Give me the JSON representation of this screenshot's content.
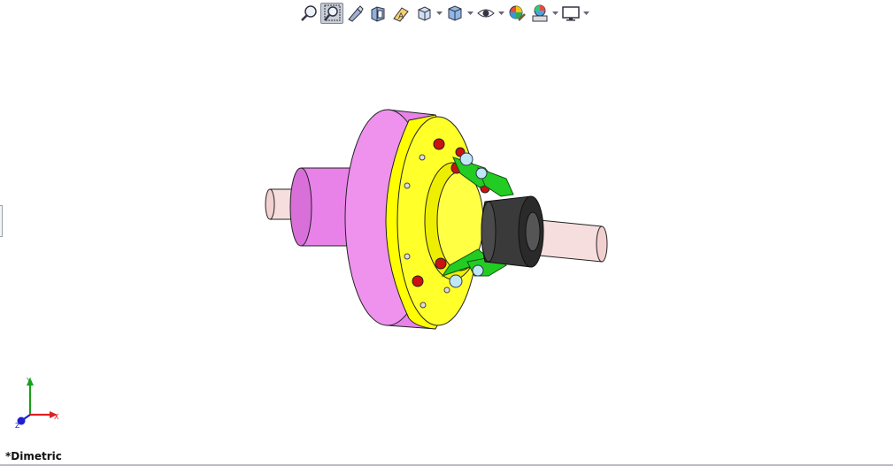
{
  "toolbar": {
    "tools": [
      {
        "name": "zoom-to-fit-icon",
        "dropdown": false,
        "active": false
      },
      {
        "name": "zoom-to-area-icon",
        "dropdown": false,
        "active": true
      },
      {
        "name": "previous-view-icon",
        "dropdown": false,
        "active": false
      },
      {
        "name": "section-view-icon",
        "dropdown": false,
        "active": false
      },
      {
        "name": "dynamic-annotation-views-icon",
        "dropdown": false,
        "active": false
      },
      {
        "name": "view-orientation-icon",
        "dropdown": true,
        "active": false
      },
      {
        "name": "display-style-icon",
        "dropdown": true,
        "active": false
      },
      {
        "name": "hide-show-items-icon",
        "dropdown": true,
        "active": false
      },
      {
        "name": "edit-appearance-icon",
        "dropdown": false,
        "active": false
      },
      {
        "name": "apply-scene-icon",
        "dropdown": true,
        "active": false
      },
      {
        "name": "view-settings-icon",
        "dropdown": true,
        "active": false
      }
    ]
  },
  "viewport": {
    "view_name": "*Dimetric",
    "triad": {
      "x_label": "X",
      "y_label": "Y",
      "z_label": "Z"
    }
  },
  "colors": {
    "flywheel": "#e882e8",
    "flange": "#ffff00",
    "shaft": "#f6dede",
    "coupling": "#3a3a3a",
    "links": "#22cc22",
    "bolts": "#cc1111",
    "axis_x": "#e02020",
    "axis_y": "#1aa01a",
    "axis_z": "#2020d0"
  }
}
